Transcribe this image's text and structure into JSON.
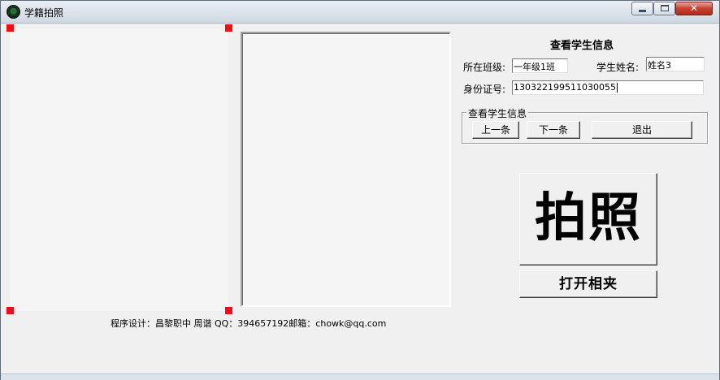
{
  "window": {
    "title": "学籍拍照",
    "icon": "app-icon",
    "controls": {
      "minimize": "minimize-icon",
      "maximize": "maximize-icon",
      "close": "✕"
    }
  },
  "info": {
    "heading": "查看学生信息",
    "class_label": "所在班级:",
    "class_value": "一年级1班",
    "name_label": "学生姓名:",
    "name_value": "姓名3",
    "id_label": "身份证号:",
    "id_value": "130322199511030055"
  },
  "navigation": {
    "legend": "查看学生信息",
    "prev_label": "上一条",
    "next_label": "下一条",
    "exit_label": "退出"
  },
  "actions": {
    "photo_label": "拍照",
    "open_album_label": "打开相夹"
  },
  "footer": {
    "text": "程序设计：昌黎职中 周谐  QQ：394657192邮箱：chowk@qq.com"
  },
  "colors": {
    "handle": "#ee1010",
    "window_bg": "#f0f0f0",
    "close_button": "#c4422f"
  }
}
